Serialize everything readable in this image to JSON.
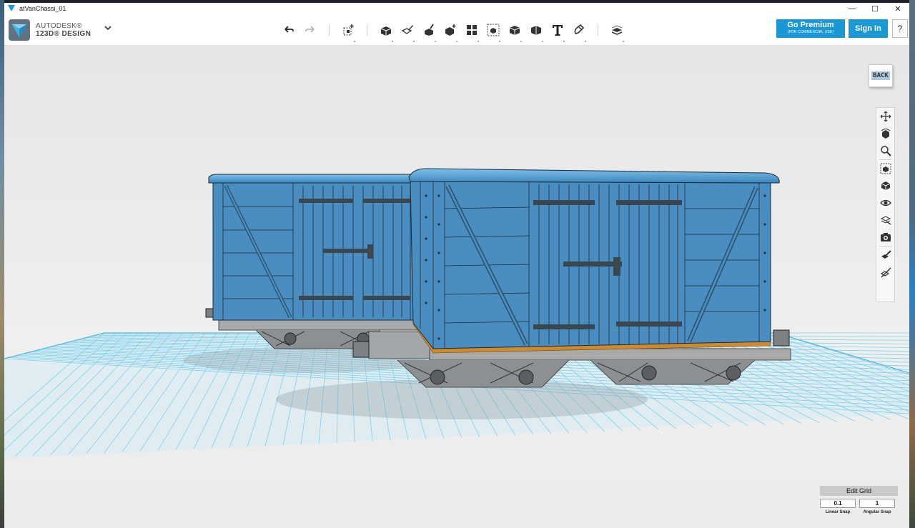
{
  "window": {
    "title": "atVanChassi_01",
    "controls": {
      "minimize": "—",
      "maximize": "☐",
      "close": "✕"
    }
  },
  "app": {
    "brand_line1": "AUTODESK®",
    "brand_line2": "123D® DESIGN",
    "menu_icon": "chevron-down-icon"
  },
  "toolbar": {
    "groups": [
      [
        "undo-icon",
        "redo-icon"
      ],
      [
        "transform-icon"
      ],
      [
        "primitives-icon",
        "sketch-icon",
        "construct-icon",
        "modify-icon",
        "pattern-icon",
        "grouping-icon",
        "combine-icon",
        "measure-icon",
        "text-icon",
        "snap-icon"
      ],
      [
        "material-icon"
      ]
    ]
  },
  "premium": {
    "label": "Go Premium",
    "sublabel": "(FOR COMMERCIAL USE)"
  },
  "signin": {
    "label": "Sign In"
  },
  "help": {
    "label": "?"
  },
  "viewcube": {
    "label": "BACK"
  },
  "navbar": {
    "items": [
      "pan-icon",
      "orbit-icon",
      "zoom-icon",
      "fit-icon",
      "view-mode-icon",
      "visibility-icon",
      "materials-outline-icon",
      "screenshot-icon",
      "snap-tool-icon",
      "hide-icon"
    ]
  },
  "grid": {
    "title": "Edit Grid",
    "linear_value": "0.1",
    "linear_label": "Linear Snap",
    "angular_value": "1",
    "angular_label": "Angular Snap"
  },
  "colors": {
    "accent": "#1a97d5",
    "model_blue": "#4a8dc0",
    "grid_line": "#7fd0ec",
    "chassis": "#9a9da0"
  }
}
